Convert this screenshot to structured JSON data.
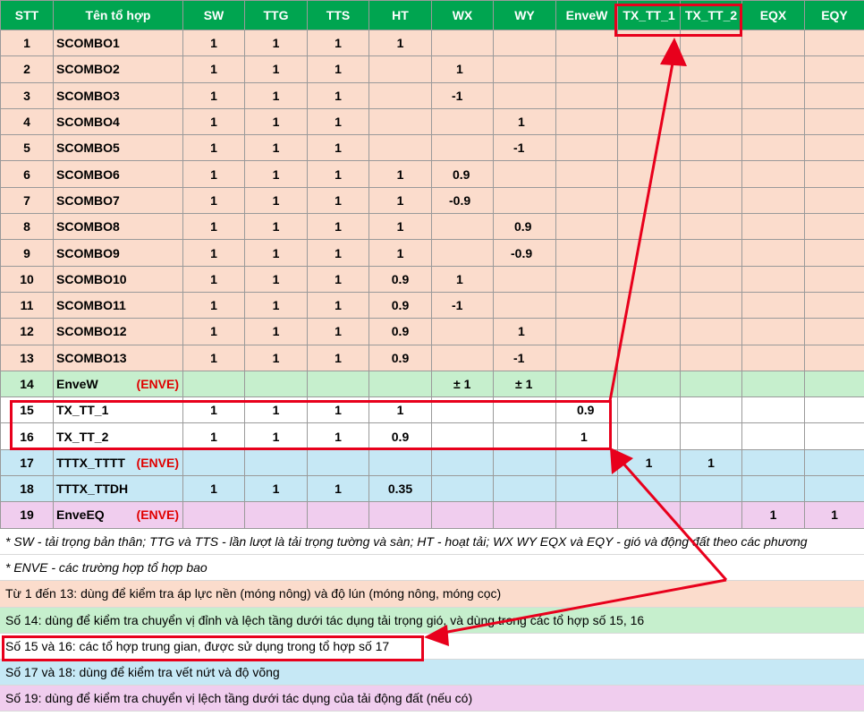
{
  "headers": [
    "STT",
    "Tên tổ hợp",
    "SW",
    "TTG",
    "TTS",
    "HT",
    "WX",
    "WY",
    "EnveW",
    "TX_TT_1",
    "TX_TT_2",
    "EQX",
    "EQY"
  ],
  "rows": [
    {
      "stt": "1",
      "name": "SCOMBO1",
      "env": "",
      "vals": [
        "1",
        "1",
        "1",
        "1",
        "",
        "",
        "",
        "",
        "",
        "",
        ""
      ],
      "color": "peach"
    },
    {
      "stt": "2",
      "name": "SCOMBO2",
      "env": "",
      "vals": [
        "1",
        "1",
        "1",
        "",
        "1",
        "",
        "",
        "",
        "",
        "",
        ""
      ],
      "color": "peach"
    },
    {
      "stt": "3",
      "name": "SCOMBO3",
      "env": "",
      "vals": [
        "1",
        "1",
        "1",
        "",
        "-1",
        "",
        "",
        "",
        "",
        "",
        ""
      ],
      "color": "peach"
    },
    {
      "stt": "4",
      "name": "SCOMBO4",
      "env": "",
      "vals": [
        "1",
        "1",
        "1",
        "",
        "",
        "1",
        "",
        "",
        "",
        "",
        ""
      ],
      "color": "peach"
    },
    {
      "stt": "5",
      "name": "SCOMBO5",
      "env": "",
      "vals": [
        "1",
        "1",
        "1",
        "",
        "",
        "-1",
        "",
        "",
        "",
        "",
        ""
      ],
      "color": "peach"
    },
    {
      "stt": "6",
      "name": "SCOMBO6",
      "env": "",
      "vals": [
        "1",
        "1",
        "1",
        "1",
        "0.9",
        "",
        "",
        "",
        "",
        "",
        ""
      ],
      "color": "peach"
    },
    {
      "stt": "7",
      "name": "SCOMBO7",
      "env": "",
      "vals": [
        "1",
        "1",
        "1",
        "1",
        "-0.9",
        "",
        "",
        "",
        "",
        "",
        ""
      ],
      "color": "peach"
    },
    {
      "stt": "8",
      "name": "SCOMBO8",
      "env": "",
      "vals": [
        "1",
        "1",
        "1",
        "1",
        "",
        "0.9",
        "",
        "",
        "",
        "",
        ""
      ],
      "color": "peach"
    },
    {
      "stt": "9",
      "name": "SCOMBO9",
      "env": "",
      "vals": [
        "1",
        "1",
        "1",
        "1",
        "",
        "-0.9",
        "",
        "",
        "",
        "",
        ""
      ],
      "color": "peach"
    },
    {
      "stt": "10",
      "name": "SCOMBO10",
      "env": "",
      "vals": [
        "1",
        "1",
        "1",
        "0.9",
        "1",
        "",
        "",
        "",
        "",
        "",
        ""
      ],
      "color": "peach"
    },
    {
      "stt": "11",
      "name": "SCOMBO11",
      "env": "",
      "vals": [
        "1",
        "1",
        "1",
        "0.9",
        "-1",
        "",
        "",
        "",
        "",
        "",
        ""
      ],
      "color": "peach"
    },
    {
      "stt": "12",
      "name": "SCOMBO12",
      "env": "",
      "vals": [
        "1",
        "1",
        "1",
        "0.9",
        "",
        "1",
        "",
        "",
        "",
        "",
        ""
      ],
      "color": "peach"
    },
    {
      "stt": "13",
      "name": "SCOMBO13",
      "env": "",
      "vals": [
        "1",
        "1",
        "1",
        "0.9",
        "",
        "-1",
        "",
        "",
        "",
        "",
        ""
      ],
      "color": "peach"
    },
    {
      "stt": "14",
      "name": "EnveW",
      "env": "(ENVE)",
      "vals": [
        "",
        "",
        "",
        "",
        "± 1",
        "± 1",
        "",
        "",
        "",
        "",
        ""
      ],
      "color": "green"
    },
    {
      "stt": "15",
      "name": "TX_TT_1",
      "env": "",
      "vals": [
        "1",
        "1",
        "1",
        "1",
        "",
        "",
        "0.9",
        "",
        "",
        "",
        ""
      ],
      "color": "white"
    },
    {
      "stt": "16",
      "name": "TX_TT_2",
      "env": "",
      "vals": [
        "1",
        "1",
        "1",
        "0.9",
        "",
        "",
        "1",
        "",
        "",
        "",
        ""
      ],
      "color": "white"
    },
    {
      "stt": "17",
      "name": "TTTX_TTTT",
      "env": "(ENVE)",
      "vals": [
        "",
        "",
        "",
        "",
        "",
        "",
        "",
        "1",
        "1",
        "",
        ""
      ],
      "color": "blue"
    },
    {
      "stt": "18",
      "name": "TTTX_TTDH",
      "env": "",
      "vals": [
        "1",
        "1",
        "1",
        "0.35",
        "",
        "",
        "",
        "",
        "",
        "",
        ""
      ],
      "color": "blue"
    },
    {
      "stt": "19",
      "name": "EnveEQ",
      "env": "(ENVE)",
      "vals": [
        "",
        "",
        "",
        "",
        "",
        "",
        "",
        "",
        "",
        "1",
        "1"
      ],
      "color": "purple"
    }
  ],
  "notes": [
    {
      "text": "* SW - tải trọng bản thân; TTG và TTS - lần lượt là tải trọng tường và sàn; HT - hoạt tải; WX WY EQX và EQY - gió và động đất theo các phương",
      "style": "it"
    },
    {
      "text": "* ENVE - các trường hợp tổ hợp bao",
      "style": "it"
    },
    {
      "text": "Từ 1 đến 13: dùng để kiểm tra áp lực nền (móng nông) và độ lún (móng nông, móng cọc)",
      "style": "peach"
    },
    {
      "text": "Số 14: dùng để kiểm tra chuyển vị đỉnh và lệch tầng dưới tác dụng tải trọng gió, và dùng trong các tổ hợp số 15, 16",
      "style": "green"
    },
    {
      "text": "Số 15 và 16: các tổ hợp trung gian, được sử dụng trong tổ hợp số 17",
      "style": "white"
    },
    {
      "text": "Số 17 và 18: dùng để kiểm tra vết nứt và độ võng",
      "style": "blue"
    },
    {
      "text": "Số 19: dùng để kiểm tra chuyển vị lệch tầng dưới tác dụng của tải động đất (nếu có)",
      "style": "purple"
    }
  ],
  "colors": {
    "header": "#00a550",
    "peach": "#fbdccc",
    "green": "#c6efcd",
    "blue": "#c6e8f5",
    "purple": "#f0cdee",
    "highlight": "#e8001c",
    "env_text": "#e00000"
  }
}
